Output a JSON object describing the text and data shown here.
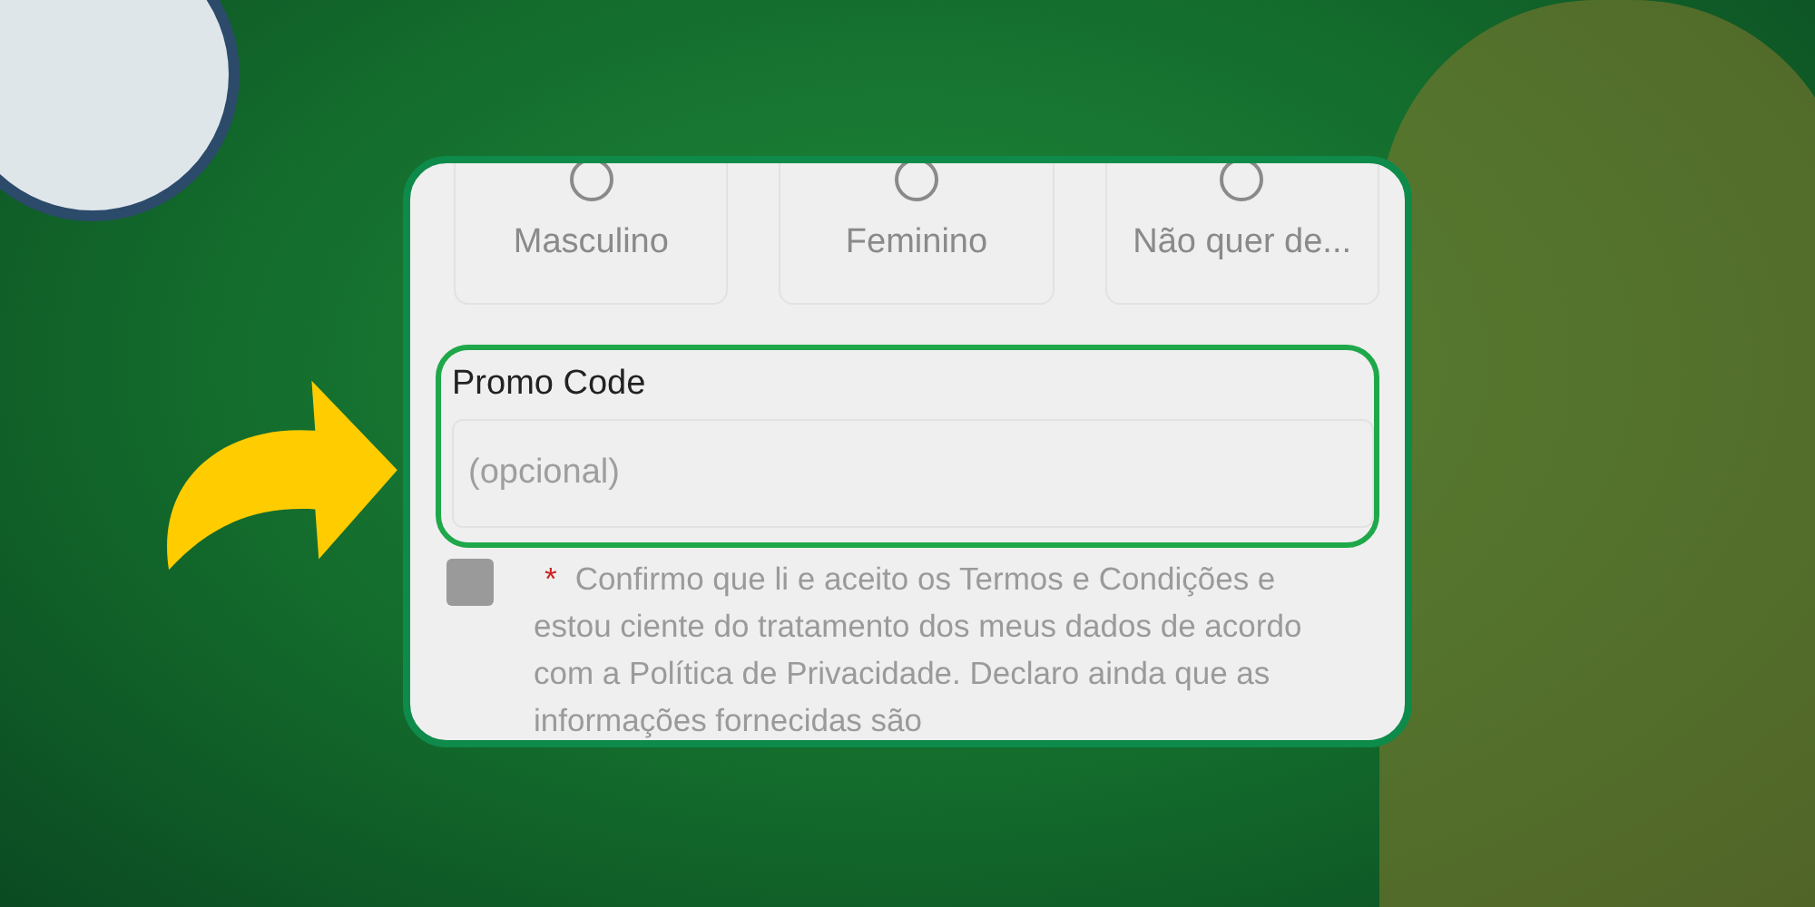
{
  "gender_options": [
    {
      "label": "Masculino",
      "selected": false
    },
    {
      "label": "Feminino",
      "selected": false
    },
    {
      "label": "Não quer de...",
      "selected": false
    }
  ],
  "promo_code": {
    "label": "Promo Code",
    "placeholder": "(opcional)",
    "highlighted": true
  },
  "terms": {
    "checked": false,
    "required_mark": "*",
    "text": "Confirmo que li e aceito os Termos e Condições e estou ciente do tratamento dos meus dados de acordo com a Política de Privacidade. Declaro ainda que as informações fornecidas são"
  }
}
